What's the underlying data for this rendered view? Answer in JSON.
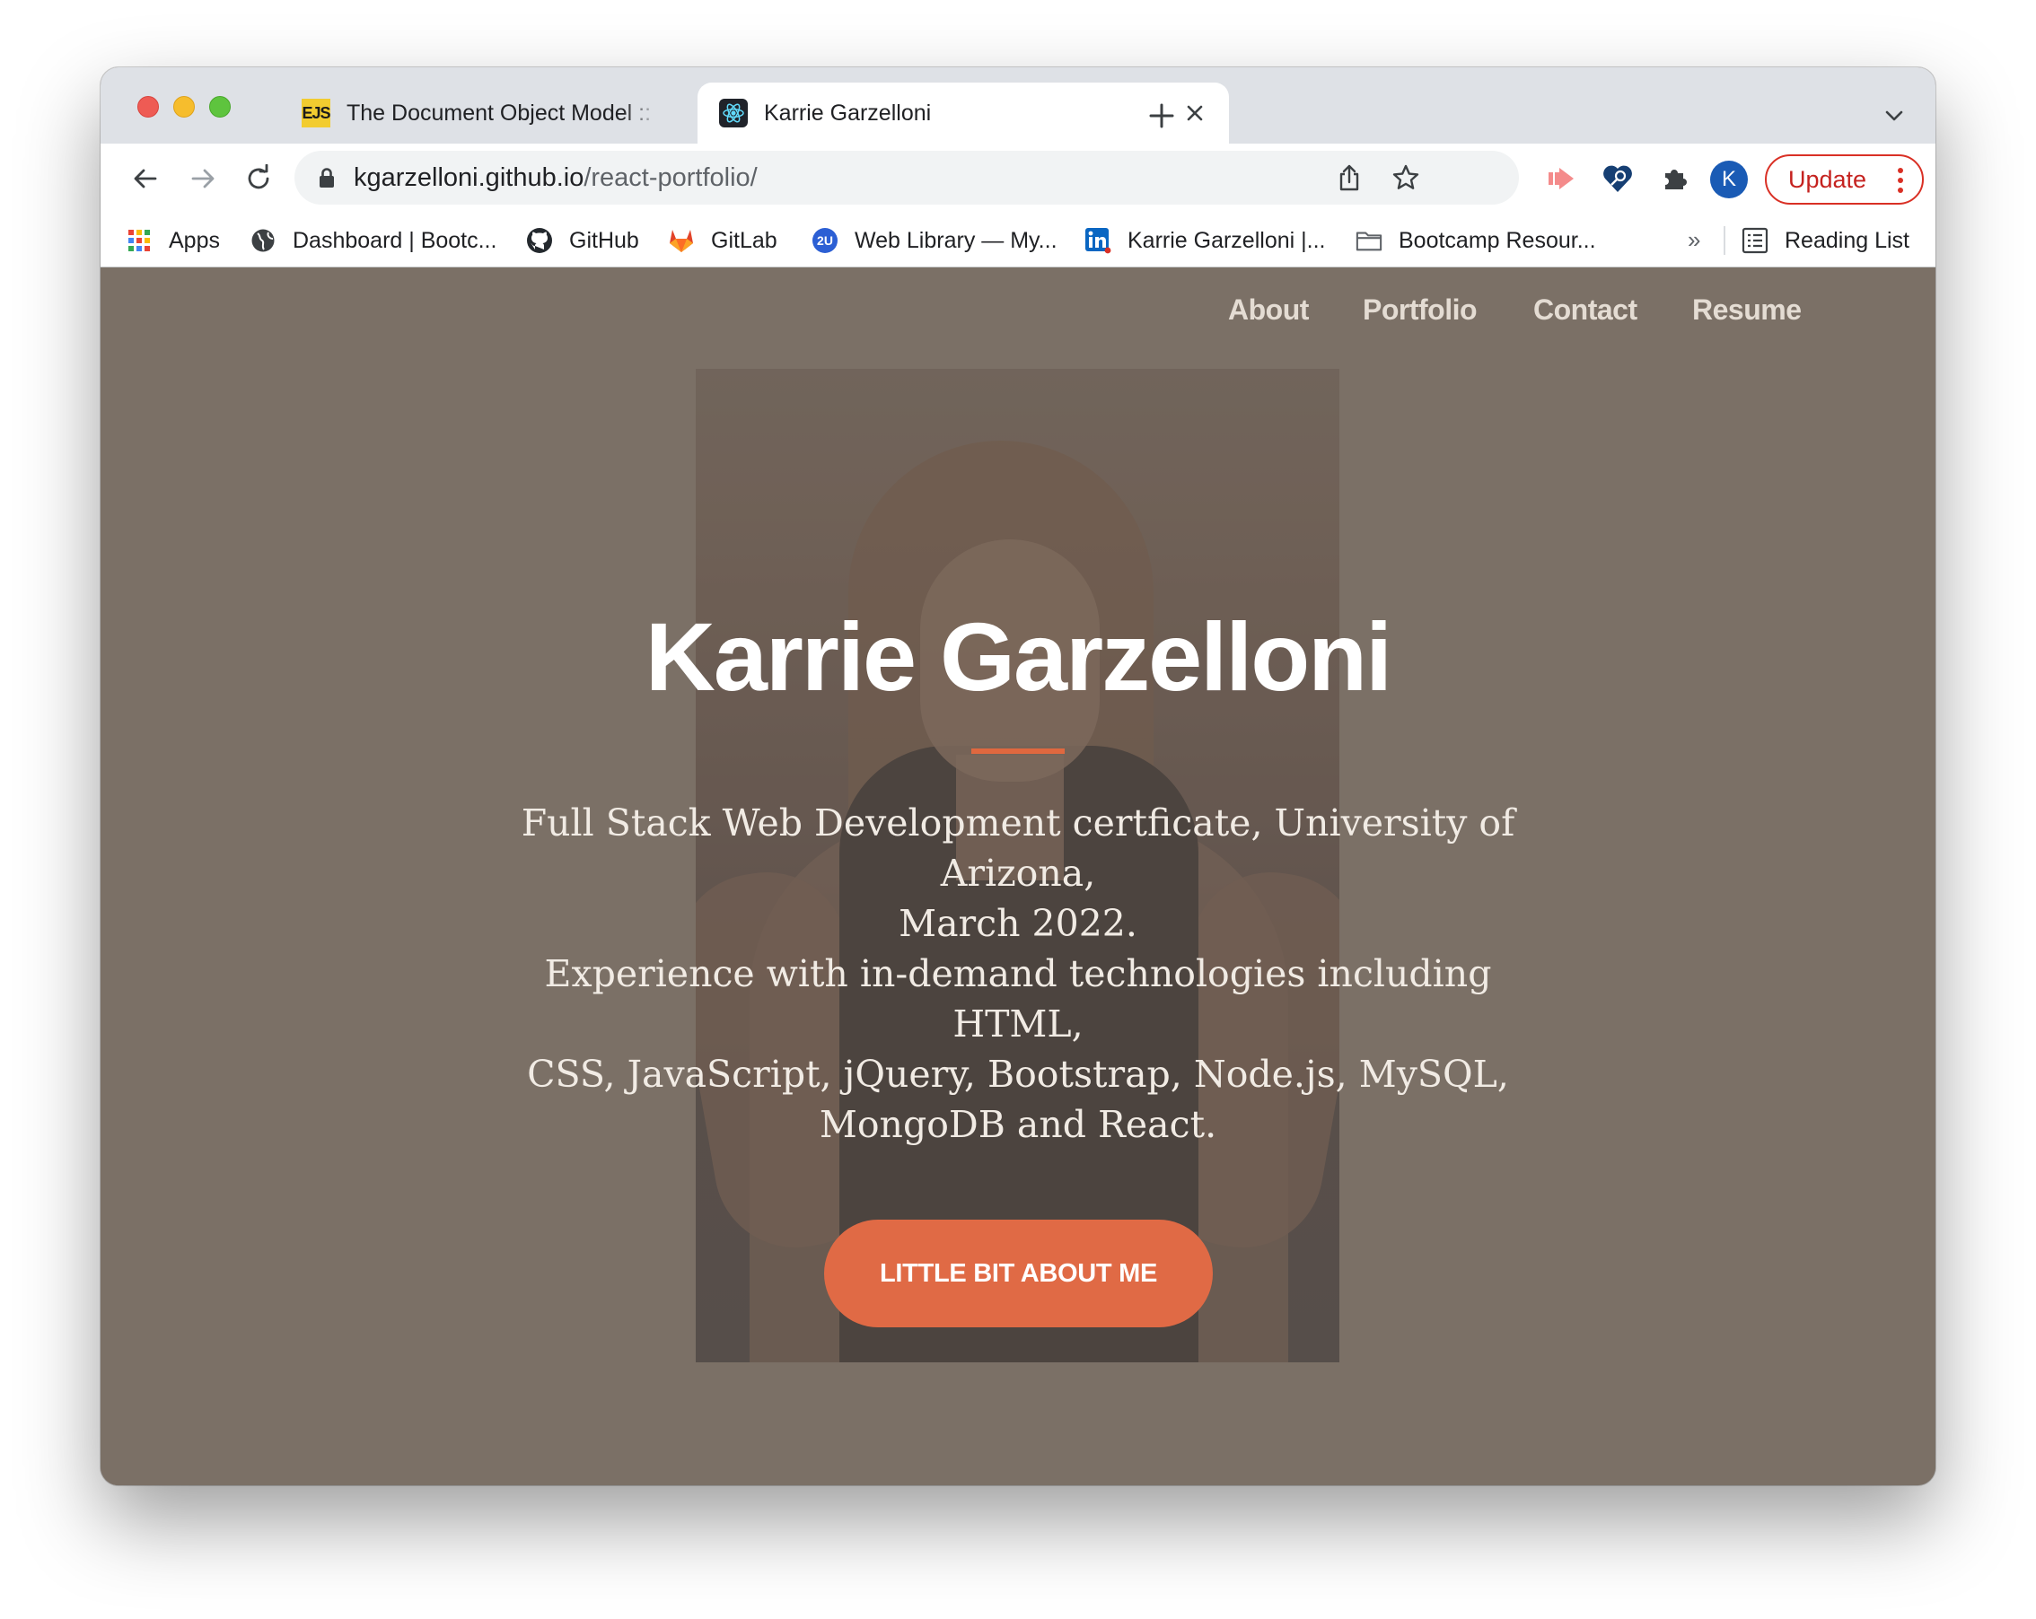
{
  "browser": {
    "tabs": [
      {
        "title": "The Document Object Model ::",
        "favicon": "EJS",
        "active": false
      },
      {
        "title": "Karrie Garzelloni",
        "favicon": "react-icon",
        "active": true
      }
    ],
    "url": {
      "host": "kgarzelloni.github.io",
      "path": "/react-portfolio/"
    },
    "profile_initial": "K",
    "update_label": "Update",
    "bookmarks": [
      {
        "label": "Apps",
        "icon": "apps-grid-icon"
      },
      {
        "label": "Dashboard | Bootc...",
        "icon": "globe-icon"
      },
      {
        "label": "GitHub",
        "icon": "github-icon"
      },
      {
        "label": "GitLab",
        "icon": "gitlab-icon"
      },
      {
        "label": "Web Library — My...",
        "icon": "2u-icon"
      },
      {
        "label": "Karrie Garzelloni |...",
        "icon": "linkedin-icon"
      },
      {
        "label": "Bootcamp Resour...",
        "icon": "folder-icon"
      }
    ],
    "bookmarks_overflow": "»",
    "reading_list": "Reading List"
  },
  "page": {
    "nav": [
      "About",
      "Portfolio",
      "Contact",
      "Resume"
    ],
    "hero": {
      "title": "Karrie Garzelloni",
      "subtitle_lines": [
        "Full Stack Web Development certficate, University of Arizona,",
        "March 2022.",
        "Experience with in-demand technologies including HTML,",
        "CSS, JavaScript, jQuery, Bootstrap, Node.js, MySQL,",
        "MongoDB and React."
      ],
      "cta": "LITTLE BIT ABOUT ME"
    },
    "colors": {
      "background": "#7b7066",
      "accent": "#e06a45",
      "update_red": "#d93025"
    }
  }
}
